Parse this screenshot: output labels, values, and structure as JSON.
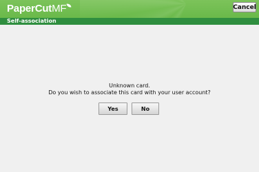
{
  "header": {
    "logo_brand": "PaperCut",
    "logo_suffix": "MF",
    "cancel_label": "Cancel"
  },
  "subheader": {
    "title": "Self-association"
  },
  "dialog": {
    "line1": "Unknown card.",
    "line2": "Do you wish to associate this card with your user account?",
    "yes_label": "Yes",
    "no_label": "No"
  },
  "colors": {
    "header_green": "#6ab94a",
    "subheader_green": "#2f8e3f",
    "background": "#f0f0f0"
  }
}
